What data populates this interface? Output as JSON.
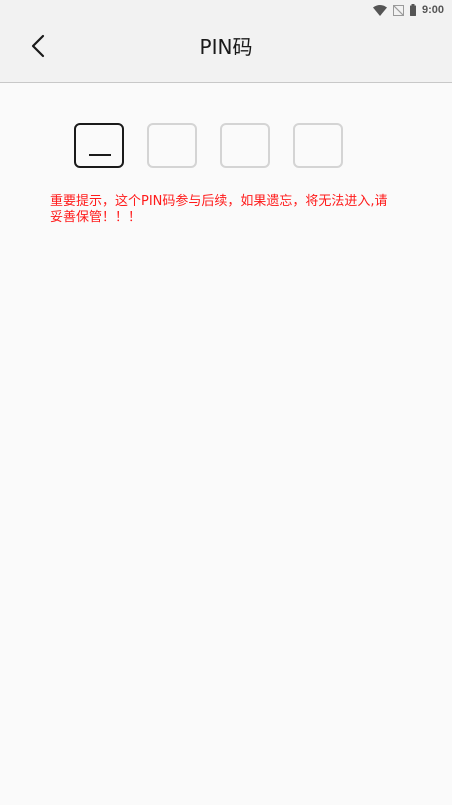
{
  "status_bar": {
    "time": "9:00",
    "icons": [
      "wifi-icon",
      "no-signal-icon",
      "battery-icon"
    ]
  },
  "toolbar": {
    "back_icon": "chevron-left-icon",
    "title": "PIN码"
  },
  "pin": {
    "length": 4,
    "active_index": 0,
    "digits": [
      "",
      "",
      "",
      ""
    ]
  },
  "warning": {
    "text": "重要提示，这个PIN码参与后续，如果遗忘，将无法进入,请妥善保管！！！"
  },
  "colors": {
    "warning": "#ff1a1a",
    "active_border": "#1a1a1a",
    "inactive_border": "#d4d4d4",
    "toolbar_bg": "#f2f2f2",
    "page_bg": "#fafafa"
  }
}
